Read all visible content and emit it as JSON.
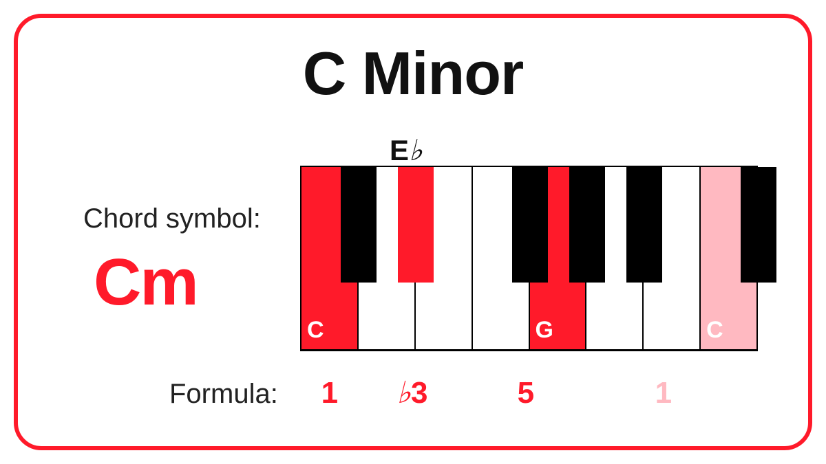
{
  "title": "C Minor",
  "chord_symbol": {
    "label": "Chord symbol:",
    "value": "Cm"
  },
  "black_key_label": {
    "letter": "E",
    "accidental": "♭"
  },
  "keyboard": {
    "white_keys": [
      {
        "note": "C",
        "highlight": "red",
        "label": "C"
      },
      {
        "note": "D",
        "highlight": "none",
        "label": ""
      },
      {
        "note": "E",
        "highlight": "none",
        "label": ""
      },
      {
        "note": "F",
        "highlight": "none",
        "label": ""
      },
      {
        "note": "G",
        "highlight": "red",
        "label": "G"
      },
      {
        "note": "A",
        "highlight": "none",
        "label": ""
      },
      {
        "note": "B",
        "highlight": "none",
        "label": ""
      },
      {
        "note": "C2",
        "highlight": "pink",
        "label": "C"
      }
    ],
    "black_keys": [
      {
        "note": "C#",
        "highlight": "none"
      },
      {
        "note": "Eb",
        "highlight": "red"
      },
      {
        "note": "F#",
        "highlight": "none"
      },
      {
        "note": "G#",
        "highlight": "none"
      },
      {
        "note": "Bb",
        "highlight": "none"
      },
      {
        "note": "C#2",
        "highlight": "none"
      }
    ]
  },
  "formula": {
    "label": "Formula:",
    "items": [
      {
        "text": "1",
        "accidental": "",
        "color": "red"
      },
      {
        "text": "3",
        "accidental": "♭",
        "color": "red"
      },
      {
        "text": "5",
        "accidental": "",
        "color": "red"
      },
      {
        "text": "1",
        "accidental": "",
        "color": "pink"
      }
    ]
  },
  "colors": {
    "accent_red": "#ff1a2a",
    "accent_pink": "#ffb9c1",
    "border": "#ff1a2a"
  }
}
